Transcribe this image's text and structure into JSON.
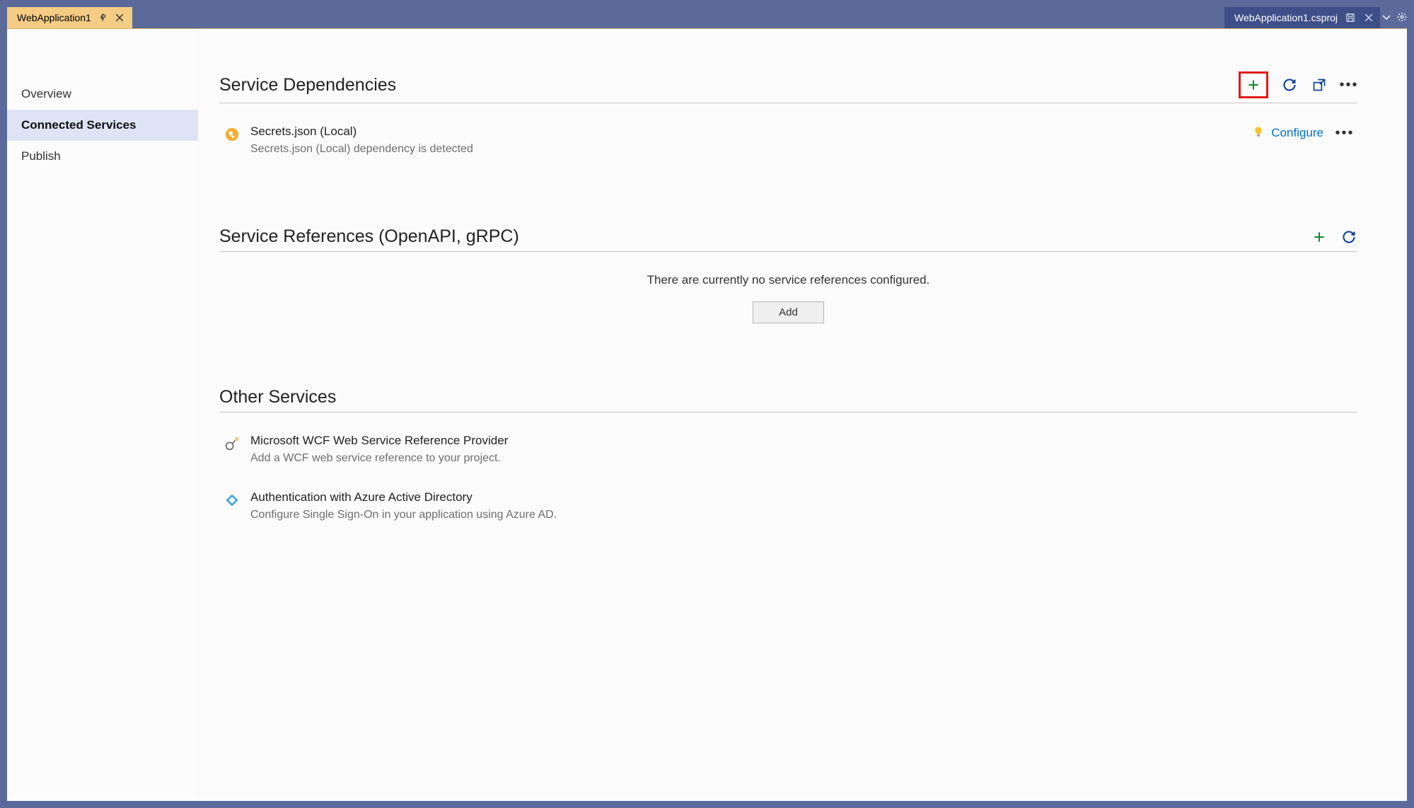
{
  "tabs": {
    "left": {
      "label": "WebApplication1"
    },
    "right": {
      "label": "WebApplication1.csproj"
    }
  },
  "sidebar": {
    "items": [
      {
        "label": "Overview"
      },
      {
        "label": "Connected Services"
      },
      {
        "label": "Publish"
      }
    ]
  },
  "dependencies": {
    "title": "Service Dependencies",
    "items": [
      {
        "title": "Secrets.json (Local)",
        "desc": "Secrets.json (Local) dependency is detected",
        "action": "Configure"
      }
    ]
  },
  "references": {
    "title": "Service References (OpenAPI, gRPC)",
    "empty_msg": "There are currently no service references configured.",
    "add_btn": "Add"
  },
  "other": {
    "title": "Other Services",
    "items": [
      {
        "title": "Microsoft WCF Web Service Reference Provider",
        "desc": "Add a WCF web service reference to your project."
      },
      {
        "title": "Authentication with Azure Active Directory",
        "desc": "Configure Single Sign-On in your application using Azure AD."
      }
    ]
  }
}
